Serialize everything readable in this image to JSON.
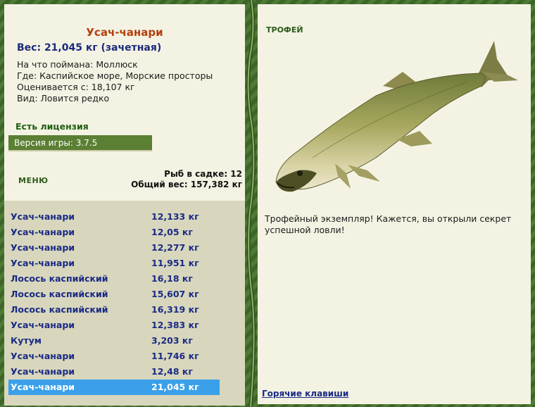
{
  "fish": {
    "name": "Усач-чанари",
    "weight_line": "Вес: 21,045 кг (зачетная)",
    "bait": "На что поймана: Моллюск",
    "location": "Где: Каспийское море, Морские просторы",
    "value": "Оценивается с: 18,107 кг",
    "kind": "Вид: Ловится редко"
  },
  "license": "Есть лицензия",
  "version": "Версия игры: 3.7.5",
  "menu_label": "МЕНЮ",
  "cage": {
    "count": "Рыб в садке: 12",
    "total": "Общий вес: 157,382 кг"
  },
  "catch_list": [
    {
      "name": "Усач-чанари",
      "weight": "12,133 кг"
    },
    {
      "name": "Усач-чанари",
      "weight": "12,05 кг"
    },
    {
      "name": "Усач-чанари",
      "weight": "12,277 кг"
    },
    {
      "name": "Усач-чанари",
      "weight": "11,951 кг"
    },
    {
      "name": "Лосось каспийский",
      "weight": "16,18 кг"
    },
    {
      "name": "Лосось каспийский",
      "weight": "15,607 кг"
    },
    {
      "name": "Лосось каспийский",
      "weight": "16,319 кг"
    },
    {
      "name": "Усач-чанари",
      "weight": "12,383 кг"
    },
    {
      "name": "Кутум",
      "weight": "3,203 кг"
    },
    {
      "name": "Усач-чанари",
      "weight": "11,746 кг"
    },
    {
      "name": "Усач-чанари",
      "weight": "12,48 кг"
    },
    {
      "name": "Усач-чанари",
      "weight": "21,045 кг"
    }
  ],
  "selected_index": 11,
  "trophy_label": "ТРОФЕЙ",
  "trophy_text": "Трофейный экземпляр! Кажется, вы открыли секрет успешной ловли!",
  "hotkeys_link": "Горячие клавиши",
  "colors": {
    "selected": "#3aa0ea",
    "frame": "#3f6a2c",
    "panel": "#f4f3e3"
  }
}
